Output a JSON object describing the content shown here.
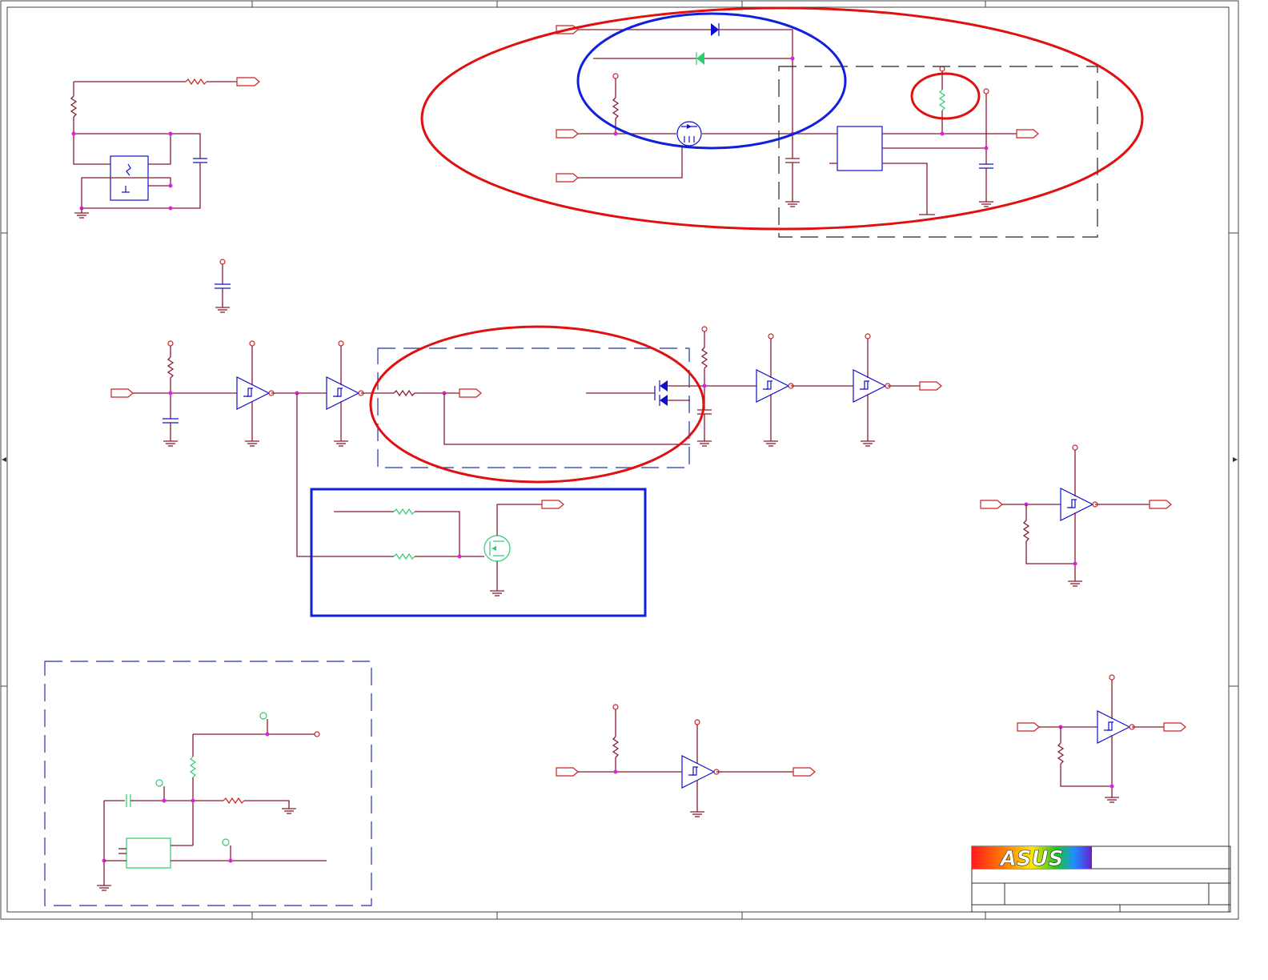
{
  "title_block": {
    "logo_text": "ASUS"
  },
  "colors": {
    "wire": "#8b1a2e",
    "symbol": "#1010cc",
    "highlight_symbol": "#2ecc71",
    "annotation_red": "#e01010",
    "annotation_blue": "#1020dd",
    "junction": "#dd22dd"
  },
  "icons": [
    "resistor-icon",
    "capacitor-icon",
    "diode-icon",
    "mosfet-icon",
    "buffer-icon",
    "ground-icon",
    "power-port-icon",
    "off-page-connector-icon",
    "asus-logo"
  ]
}
